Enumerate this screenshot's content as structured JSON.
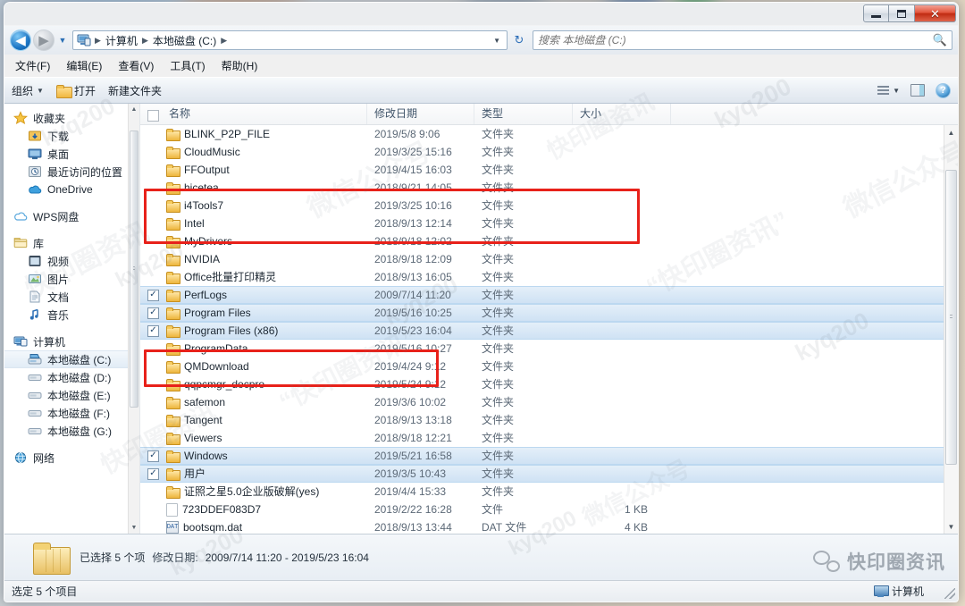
{
  "window": {
    "controls": {
      "minimize": "—",
      "maximize": "□",
      "close": "✕"
    }
  },
  "address": {
    "back_label": "◀",
    "forward_label": "▶",
    "recent_caret": "▼",
    "computer_icon": "computer-icon",
    "crumbs": [
      "计算机",
      "本地磁盘 (C:)"
    ],
    "separator": "▶",
    "dropdown_caret": "▼",
    "refresh_label": "↻"
  },
  "search": {
    "placeholder": "搜索 本地磁盘 (C:)",
    "value": "",
    "icon": "search-icon"
  },
  "menu": {
    "items": [
      "文件(F)",
      "编辑(E)",
      "查看(V)",
      "工具(T)",
      "帮助(H)"
    ]
  },
  "command_bar": {
    "organize": "组织",
    "organize_caret": "▼",
    "open": "打开",
    "new_folder": "新建文件夹",
    "view_caret": "▼",
    "icons": [
      "view-list-icon",
      "chevron-down-icon",
      "preview-pane-icon",
      "help-icon"
    ],
    "help_glyph": "?"
  },
  "sidebar": {
    "groups": [
      {
        "header": {
          "label": "收藏夹",
          "icon": "star-icon",
          "level": 1
        },
        "items": [
          {
            "label": "下载",
            "icon": "downloads-icon"
          },
          {
            "label": "桌面",
            "icon": "desktop-icon"
          },
          {
            "label": "最近访问的位置",
            "icon": "recent-places-icon"
          },
          {
            "label": "OneDrive",
            "icon": "onedrive-icon"
          }
        ]
      },
      {
        "header": {
          "label": "WPS网盘",
          "icon": "cloud-icon",
          "level": 1
        },
        "items": []
      },
      {
        "header": {
          "label": "库",
          "icon": "library-icon",
          "level": 1
        },
        "items": [
          {
            "label": "视频",
            "icon": "video-icon"
          },
          {
            "label": "图片",
            "icon": "pictures-icon"
          },
          {
            "label": "文档",
            "icon": "documents-icon"
          },
          {
            "label": "音乐",
            "icon": "music-icon"
          }
        ]
      },
      {
        "header": {
          "label": "计算机",
          "icon": "computer-icon",
          "level": 1
        },
        "items": [
          {
            "label": "本地磁盘 (C:)",
            "icon": "system-drive-icon",
            "selected": true
          },
          {
            "label": "本地磁盘 (D:)",
            "icon": "drive-icon"
          },
          {
            "label": "本地磁盘 (E:)",
            "icon": "drive-icon"
          },
          {
            "label": "本地磁盘 (F:)",
            "icon": "drive-icon"
          },
          {
            "label": "本地磁盘 (G:)",
            "icon": "drive-icon"
          }
        ]
      },
      {
        "header": {
          "label": "网络",
          "icon": "network-icon",
          "level": 1
        },
        "items": []
      }
    ]
  },
  "file_list": {
    "columns": [
      "名称",
      "修改日期",
      "类型",
      "大小"
    ],
    "rows": [
      {
        "name": "BLINK_P2P_FILE",
        "date": "2019/5/8 9:06",
        "type": "文件夹",
        "size": "",
        "icon": "folder-icon",
        "selected": false
      },
      {
        "name": "CloudMusic",
        "date": "2019/3/25 15:16",
        "type": "文件夹",
        "size": "",
        "icon": "folder-icon",
        "selected": false
      },
      {
        "name": "FFOutput",
        "date": "2019/4/15 16:03",
        "type": "文件夹",
        "size": "",
        "icon": "folder-icon",
        "selected": false
      },
      {
        "name": "hicetea",
        "date": "2018/9/21 14:05",
        "type": "文件夹",
        "size": "",
        "icon": "folder-icon",
        "selected": false
      },
      {
        "name": "i4Tools7",
        "date": "2019/3/25 10:16",
        "type": "文件夹",
        "size": "",
        "icon": "folder-icon",
        "selected": false
      },
      {
        "name": "Intel",
        "date": "2018/9/13 12:14",
        "type": "文件夹",
        "size": "",
        "icon": "folder-icon",
        "selected": false
      },
      {
        "name": "MyDrivers",
        "date": "2018/9/18 12:02",
        "type": "文件夹",
        "size": "",
        "icon": "folder-icon",
        "selected": false
      },
      {
        "name": "NVIDIA",
        "date": "2018/9/18 12:09",
        "type": "文件夹",
        "size": "",
        "icon": "folder-icon",
        "selected": false
      },
      {
        "name": "Office批量打印精灵",
        "date": "2018/9/13 16:05",
        "type": "文件夹",
        "size": "",
        "icon": "folder-icon",
        "selected": false
      },
      {
        "name": "PerfLogs",
        "date": "2009/7/14 11:20",
        "type": "文件夹",
        "size": "",
        "icon": "folder-icon",
        "selected": true
      },
      {
        "name": "Program Files",
        "date": "2019/5/16 10:25",
        "type": "文件夹",
        "size": "",
        "icon": "folder-icon",
        "selected": true
      },
      {
        "name": "Program Files (x86)",
        "date": "2019/5/23 16:04",
        "type": "文件夹",
        "size": "",
        "icon": "folder-icon",
        "selected": true
      },
      {
        "name": "ProgramData",
        "date": "2019/5/16 10:27",
        "type": "文件夹",
        "size": "",
        "icon": "folder-icon",
        "selected": false
      },
      {
        "name": "QMDownload",
        "date": "2019/4/24 9:12",
        "type": "文件夹",
        "size": "",
        "icon": "folder-icon",
        "selected": false
      },
      {
        "name": "qqpcmgr_docpro",
        "date": "2019/5/24 9:12",
        "type": "文件夹",
        "size": "",
        "icon": "folder-icon",
        "selected": false
      },
      {
        "name": "safemon",
        "date": "2019/3/6 10:02",
        "type": "文件夹",
        "size": "",
        "icon": "folder-icon",
        "selected": false
      },
      {
        "name": "Tangent",
        "date": "2018/9/13 13:18",
        "type": "文件夹",
        "size": "",
        "icon": "folder-icon",
        "selected": false
      },
      {
        "name": "Viewers",
        "date": "2018/9/18 12:21",
        "type": "文件夹",
        "size": "",
        "icon": "folder-icon",
        "selected": false
      },
      {
        "name": "Windows",
        "date": "2019/5/21 16:58",
        "type": "文件夹",
        "size": "",
        "icon": "folder-icon",
        "selected": true
      },
      {
        "name": "用户",
        "date": "2019/3/5 10:43",
        "type": "文件夹",
        "size": "",
        "icon": "folder-icon",
        "selected": true
      },
      {
        "name": "证照之星5.0企业版破解(yes)",
        "date": "2019/4/4 15:33",
        "type": "文件夹",
        "size": "",
        "icon": "folder-icon",
        "selected": false
      },
      {
        "name": "723DDEF083D7",
        "date": "2019/2/22 16:28",
        "type": "文件",
        "size": "1 KB",
        "icon": "file-icon",
        "selected": false
      },
      {
        "name": "bootsqm.dat",
        "date": "2018/9/13 13:44",
        "type": "DAT 文件",
        "size": "4 KB",
        "icon": "dat-file-icon",
        "selected": false
      }
    ],
    "checkbox_glyph": "✓"
  },
  "details_pane": {
    "selected_count_label": "已选择 5 个项",
    "date_label": "修改日期:",
    "date_range": "2009/7/14 11:20 - 2019/5/23 16:04",
    "folder_icon": "folder-stack-icon"
  },
  "status_bar": {
    "left_text": "选定 5 个项目",
    "right_text": "计算机",
    "right_icon": "computer-icon"
  },
  "annotations": {
    "red_boxes": 2,
    "color": "#e8211a"
  },
  "watermarks": {
    "brand": "快印圈资讯",
    "wechat": "微信公众号",
    "code": "kyq200",
    "quoted_brand": "“快印圈资讯”",
    "badge_text": "快印圈资讯",
    "badge_icon": "wechat-icon"
  },
  "colors": {
    "selection": "#cfe2f4",
    "accent_blue": "#2a6fb5",
    "annotation_red": "#e8211a",
    "folder_yellow": "#edb63c"
  }
}
